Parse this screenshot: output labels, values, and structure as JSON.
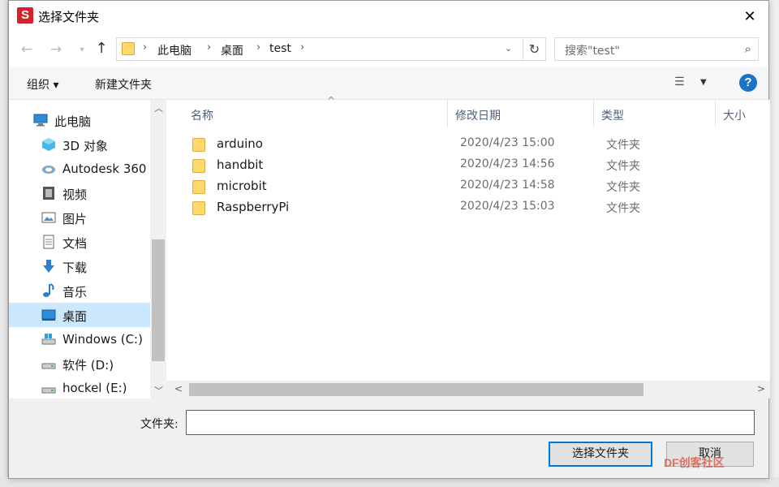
{
  "dialog": {
    "title": "选择文件夹",
    "close_glyph": "✕"
  },
  "address": {
    "crumbs": [
      "此电脑",
      "桌面",
      "test"
    ],
    "search_placeholder": "搜索\"test\""
  },
  "toolbar": {
    "organize_label": "组织 ▾",
    "new_folder_label": "新建文件夹"
  },
  "sidebar": {
    "items": [
      {
        "label": "此电脑",
        "icon": "computer-icon"
      },
      {
        "label": "3D 对象",
        "icon": "cube-icon"
      },
      {
        "label": "Autodesk 360",
        "icon": "cloud-icon"
      },
      {
        "label": "视频",
        "icon": "video-icon"
      },
      {
        "label": "图片",
        "icon": "picture-icon"
      },
      {
        "label": "文档",
        "icon": "document-icon"
      },
      {
        "label": "下载",
        "icon": "download-icon"
      },
      {
        "label": "音乐",
        "icon": "music-icon"
      },
      {
        "label": "桌面",
        "icon": "desktop-icon",
        "selected": true
      },
      {
        "label": "Windows (C:)",
        "icon": "drive-icon"
      },
      {
        "label": "软件 (D:)",
        "icon": "drive-icon"
      },
      {
        "label": "hockel (E:)",
        "icon": "drive-icon"
      }
    ]
  },
  "columns": {
    "name": "名称",
    "date": "修改日期",
    "type": "类型",
    "size": "大小"
  },
  "files": [
    {
      "name": "arduino",
      "date": "2020/4/23 15:00",
      "type": "文件夹"
    },
    {
      "name": "handbit",
      "date": "2020/4/23 14:56",
      "type": "文件夹"
    },
    {
      "name": "microbit",
      "date": "2020/4/23 14:58",
      "type": "文件夹"
    },
    {
      "name": "RaspberryPi",
      "date": "2020/4/23 15:03",
      "type": "文件夹"
    }
  ],
  "footer": {
    "folder_label": "文件夹:",
    "folder_value": "",
    "select_button": "选择文件夹",
    "cancel_button": "取消"
  },
  "watermark": "DF创客社区",
  "colors": {
    "accent": "#0078d7",
    "selected_bg": "#cce8ff",
    "folder": "#ffd76a",
    "app_icon": "#d4222a",
    "help": "#1b72c7"
  }
}
